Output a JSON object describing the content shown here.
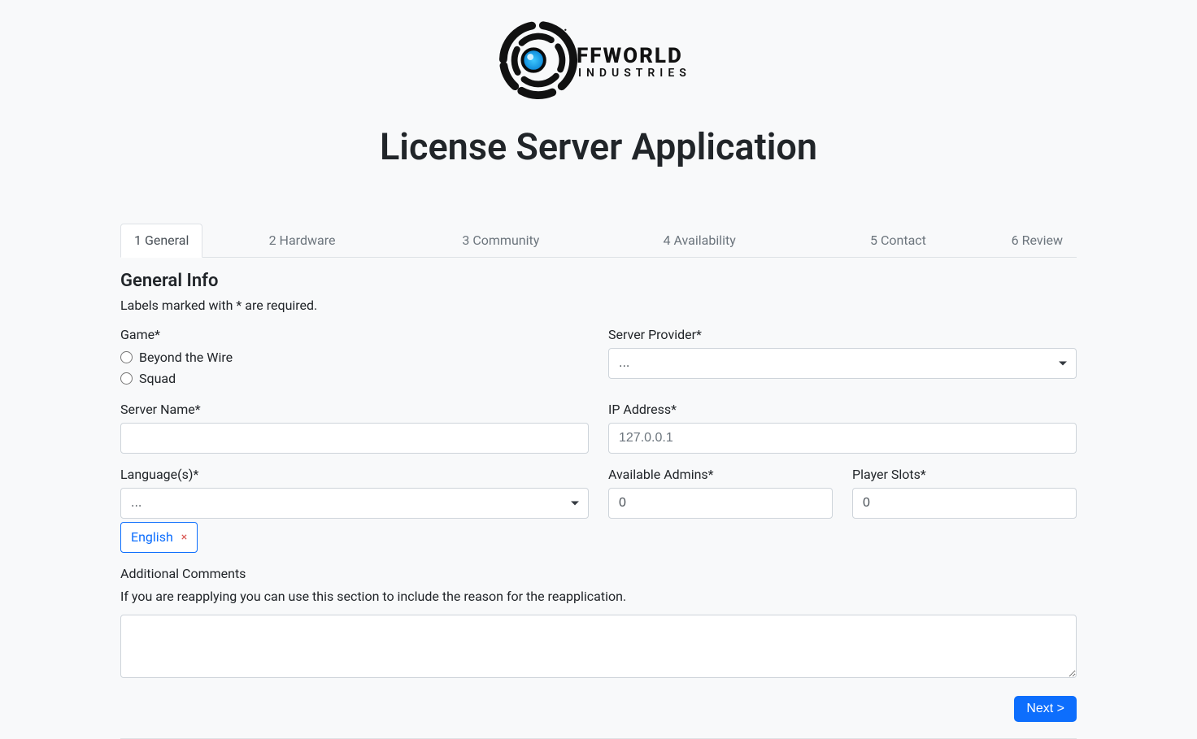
{
  "brand": {
    "text_main": "FFWORLD",
    "text_sub": "INDUSTRIES"
  },
  "page": {
    "title": "License Server Application"
  },
  "tabs": [
    {
      "label": "1 General",
      "active": true
    },
    {
      "label": "2 Hardware",
      "active": false
    },
    {
      "label": "3 Community",
      "active": false
    },
    {
      "label": "4 Availability",
      "active": false
    },
    {
      "label": "5 Contact",
      "active": false
    },
    {
      "label": "6 Review",
      "active": false
    }
  ],
  "section": {
    "title": "General Info",
    "sub": "Labels marked with * are required."
  },
  "form": {
    "game": {
      "label": "Game*",
      "options": [
        "Beyond the Wire",
        "Squad"
      ],
      "value": ""
    },
    "server_provider": {
      "label": "Server Provider*",
      "placeholder_option": "...",
      "value": ""
    },
    "server_name": {
      "label": "Server Name*",
      "value": ""
    },
    "ip_address": {
      "label": "IP Address*",
      "placeholder": "127.0.0.1",
      "value": ""
    },
    "languages": {
      "label": "Language(s)*",
      "placeholder_option": "...",
      "selected": [
        "English"
      ]
    },
    "available_admins": {
      "label": "Available Admins*",
      "value": "0"
    },
    "player_slots": {
      "label": "Player Slots*",
      "value": "0"
    },
    "additional_comments": {
      "label": "Additional Comments",
      "help": "If you are reapplying you can use this section to include the reason for the reapplication.",
      "value": ""
    }
  },
  "buttons": {
    "next": "Next >"
  }
}
